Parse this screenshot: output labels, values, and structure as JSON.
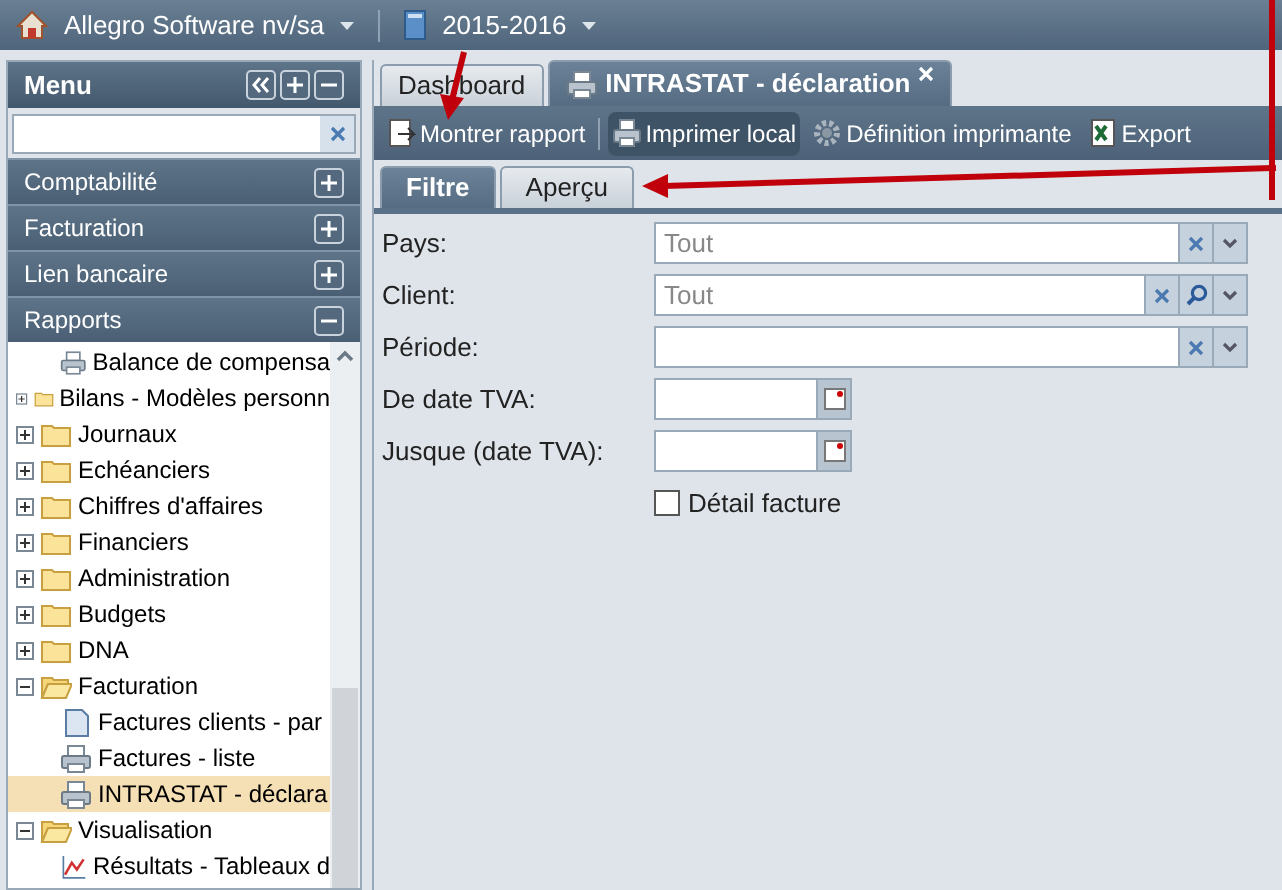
{
  "top_bar": {
    "company": "Allegro Software nv/sa",
    "year": "2015-2016"
  },
  "menu": {
    "title": "Menu",
    "sections": [
      {
        "label": "Comptabilité",
        "expanded": false
      },
      {
        "label": "Facturation",
        "expanded": false
      },
      {
        "label": "Lien bancaire",
        "expanded": false
      },
      {
        "label": "Rapports",
        "expanded": true
      }
    ],
    "tree": {
      "continued_children": [
        {
          "label": "Balance de compensa",
          "kind": "report",
          "selected": false
        }
      ],
      "items": [
        {
          "label": "Bilans - Modèles personn",
          "kind": "folder",
          "expanded": false,
          "selected": false
        },
        {
          "label": "Journaux",
          "kind": "folder",
          "expanded": false,
          "selected": false
        },
        {
          "label": "Echéanciers",
          "kind": "folder",
          "expanded": false,
          "selected": false
        },
        {
          "label": "Chiffres d'affaires",
          "kind": "folder",
          "expanded": false,
          "selected": false
        },
        {
          "label": "Financiers",
          "kind": "folder",
          "expanded": false,
          "selected": false
        },
        {
          "label": "Administration",
          "kind": "folder",
          "expanded": false,
          "selected": false
        },
        {
          "label": "Budgets",
          "kind": "folder",
          "expanded": false,
          "selected": false
        },
        {
          "label": "DNA",
          "kind": "folder",
          "expanded": false,
          "selected": false
        },
        {
          "label": "Facturation",
          "kind": "folder",
          "expanded": true,
          "selected": false,
          "children": [
            {
              "label": "Factures clients - par",
              "kind": "document",
              "selected": false
            },
            {
              "label": "Factures - liste",
              "kind": "report",
              "selected": false
            },
            {
              "label": "INTRASTAT - déclara",
              "kind": "report",
              "selected": true
            }
          ]
        },
        {
          "label": "Visualisation",
          "kind": "folder",
          "expanded": true,
          "selected": false,
          "children": [
            {
              "label": "Résultats - Tableaux d",
              "kind": "chart",
              "selected": false
            }
          ]
        }
      ]
    }
  },
  "tabs": [
    {
      "label": "Dashboard",
      "selected": false,
      "closable": false
    },
    {
      "label": "INTRASTAT - déclaration",
      "selected": true,
      "closable": true
    }
  ],
  "toolbar": [
    {
      "label": "Montrer rapport",
      "kind": "report"
    },
    {
      "label": "Imprimer local",
      "kind": "print"
    },
    {
      "label": "Définition imprimante",
      "kind": "gear"
    },
    {
      "label": "Export",
      "kind": "export"
    }
  ],
  "sub_tabs": [
    {
      "label": "Filtre",
      "selected": true
    },
    {
      "label": "Aperçu",
      "selected": false
    }
  ],
  "form": [
    {
      "label": "Pays:",
      "kind": "combo",
      "value": "Tout",
      "search": false
    },
    {
      "label": "Client:",
      "kind": "combo",
      "value": "Tout",
      "search": true
    },
    {
      "label": "Période:",
      "kind": "combo",
      "search": false
    },
    {
      "label": "De date TVA:",
      "kind": "date"
    },
    {
      "label": "Jusque (date TVA):",
      "kind": "date"
    },
    {
      "label": "Détail facture",
      "kind": "checkbox",
      "checked": false
    }
  ]
}
